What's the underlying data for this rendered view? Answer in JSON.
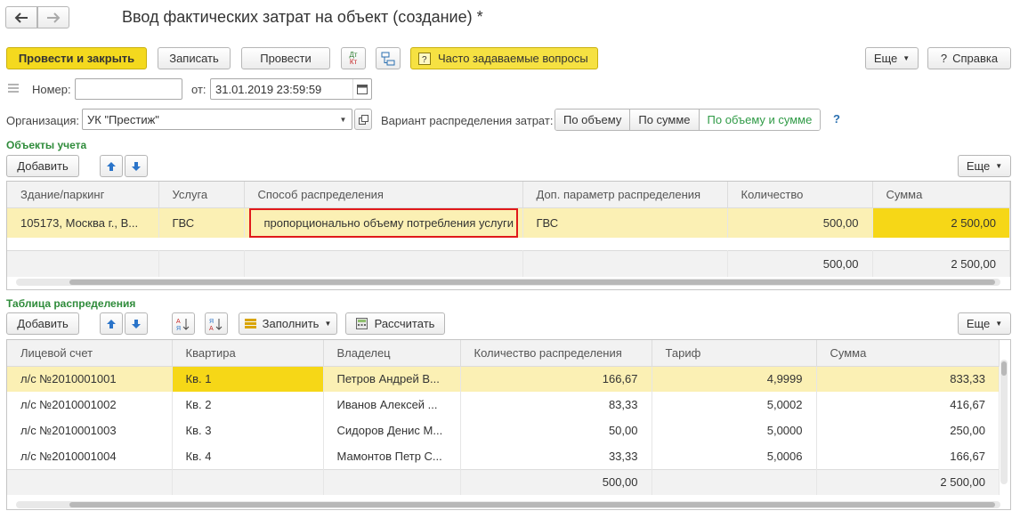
{
  "window": {
    "title": "Ввод фактических затрат на объект (создание) *"
  },
  "toolbar": {
    "post_close": "Провести и закрыть",
    "save": "Записать",
    "post": "Провести",
    "faq": "Часто задаваемые вопросы",
    "more": "Еще",
    "help": "Справка",
    "dt_kt_top": "Дт",
    "dt_kt_bottom": "Кт"
  },
  "header": {
    "number_label": "Номер:",
    "number_value": "",
    "date_label": "от:",
    "date_value": "31.01.2019 23:59:59",
    "org_label": "Организация:",
    "org_value": "УК \"Престиж\"",
    "variant_label": "Вариант распределения затрат:",
    "variant_options": [
      "По объему",
      "По сумме",
      "По объему и сумме"
    ],
    "variant_selected": "По объему и сумме",
    "help_mark": "?"
  },
  "objects": {
    "title": "Объекты учета",
    "add": "Добавить",
    "more": "Еще",
    "columns": [
      "Здание/паркинг",
      "Услуга",
      "Способ распределения",
      "Доп. параметр распределения",
      "Количество",
      "Сумма"
    ],
    "rows": [
      {
        "building": "105173, Москва г., В...",
        "service": "ГВС",
        "method": "пропорционально объему потребления услуги",
        "param": "ГВС",
        "qty": "500,00",
        "sum": "2 500,00"
      }
    ],
    "totals": {
      "qty": "500,00",
      "sum": "2 500,00"
    }
  },
  "distribution": {
    "title": "Таблица распределения",
    "add": "Добавить",
    "fill": "Заполнить",
    "calc": "Рассчитать",
    "more": "Еще",
    "columns": [
      "Лицевой счет",
      "Квартира",
      "Владелец",
      "Количество распределения",
      "Тариф",
      "Сумма"
    ],
    "rows": [
      {
        "account": "л/с №2010001001",
        "flat": "Кв. 1",
        "owner": "Петров Андрей В...",
        "qty": "166,67",
        "tariff": "4,9999",
        "sum": "833,33"
      },
      {
        "account": "л/с №2010001002",
        "flat": "Кв. 2",
        "owner": "Иванов Алексей ...",
        "qty": "83,33",
        "tariff": "5,0002",
        "sum": "416,67"
      },
      {
        "account": "л/с №2010001003",
        "flat": "Кв. 3",
        "owner": "Сидоров Денис М...",
        "qty": "50,00",
        "tariff": "5,0000",
        "sum": "250,00"
      },
      {
        "account": "л/с №2010001004",
        "flat": "Кв. 4",
        "owner": "Мамонтов Петр С...",
        "qty": "33,33",
        "tariff": "5,0006",
        "sum": "166,67"
      }
    ],
    "totals": {
      "qty": "500,00",
      "sum": "2 500,00"
    }
  },
  "colors": {
    "accent_yellow": "#f4d91e",
    "section_green": "#2e8b3a",
    "highlight_red": "#e0191b",
    "selected_row": "#fbf0b4"
  }
}
